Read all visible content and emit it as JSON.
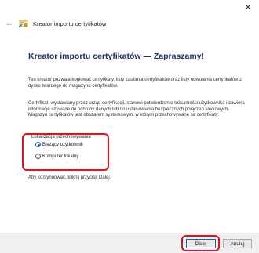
{
  "window": {
    "close_glyph": "✕"
  },
  "header": {
    "back_glyph": "←",
    "title": "Kreator importu certyfikatów"
  },
  "main": {
    "heading": "Kreator importu certyfikatów — Zapraszamy!",
    "intro": "Ten kreator pozwala kopiować certyfikaty, listy zaufania certyfikatów oraz listy odwołania certyfikatów z dysku twardego do magazynu certyfikatów.",
    "description": "Certyfikat, wystawiany przez urząd certyfikacji, stanowi potwierdzenie tożsamości użytkownika i zawiera informacje używane do ochrony danych lub do ustanawiania bezpiecznych połączeń sieciowych. Magazyn certyfikatów jest obszarem systemowym, w którym przechowywane są certyfikaty.",
    "store_location": {
      "label": "Lokalizacja przechowywania",
      "options": [
        {
          "label": "Bieżący użytkownik",
          "selected": true
        },
        {
          "label": "Komputer lokalny",
          "selected": false
        }
      ]
    },
    "continue_hint": "Aby kontynuować, kliknij przycisk Dalej."
  },
  "footer": {
    "next_label": "Dalej",
    "cancel_label": "Anuluj"
  },
  "colors": {
    "heading": "#1f2f6a",
    "highlight": "#e0141d",
    "accent": "#1a5fb4"
  },
  "icons": {
    "wizard": "certificate-wizard-icon",
    "back": "back-arrow-icon",
    "close": "close-icon"
  }
}
